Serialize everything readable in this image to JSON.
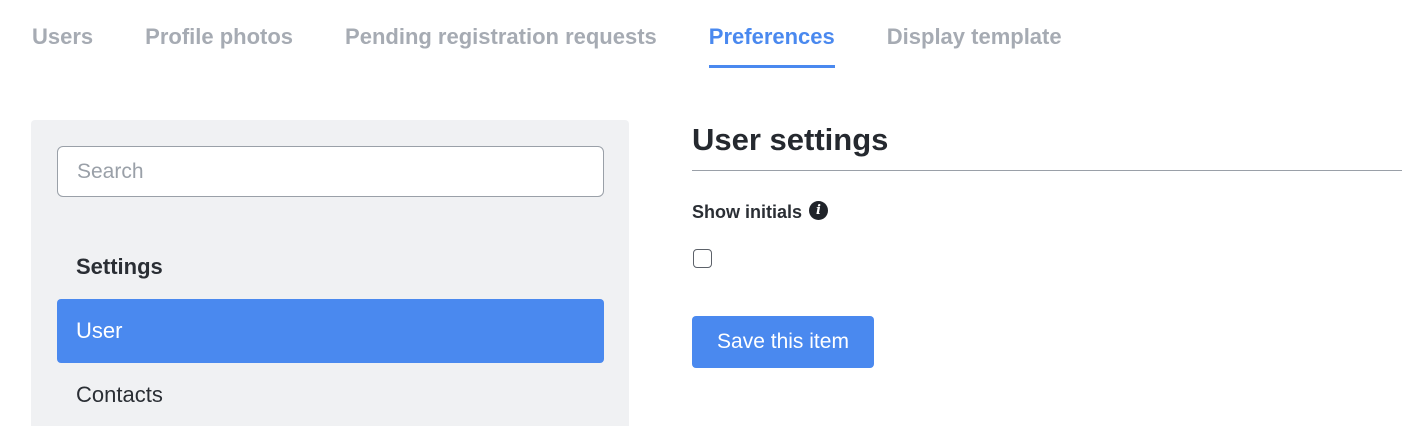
{
  "tabs": [
    {
      "label": "Users",
      "active": false
    },
    {
      "label": "Profile photos",
      "active": false
    },
    {
      "label": "Pending registration requests",
      "active": false
    },
    {
      "label": "Preferences",
      "active": true
    },
    {
      "label": "Display template",
      "active": false
    }
  ],
  "sidebar": {
    "search": {
      "placeholder": "Search",
      "value": ""
    },
    "section_heading": "Settings",
    "items": [
      {
        "label": "User",
        "active": true
      },
      {
        "label": "Contacts",
        "active": false
      }
    ]
  },
  "main": {
    "title": "User settings",
    "field": {
      "label": "Show initials",
      "info_icon": "info-icon",
      "checked": false
    },
    "save_label": "Save this item"
  },
  "colors": {
    "accent": "#4a89ef",
    "tab_inactive": "#a6abb3",
    "sidebar_bg": "#f0f1f3",
    "text": "#1f2329"
  }
}
